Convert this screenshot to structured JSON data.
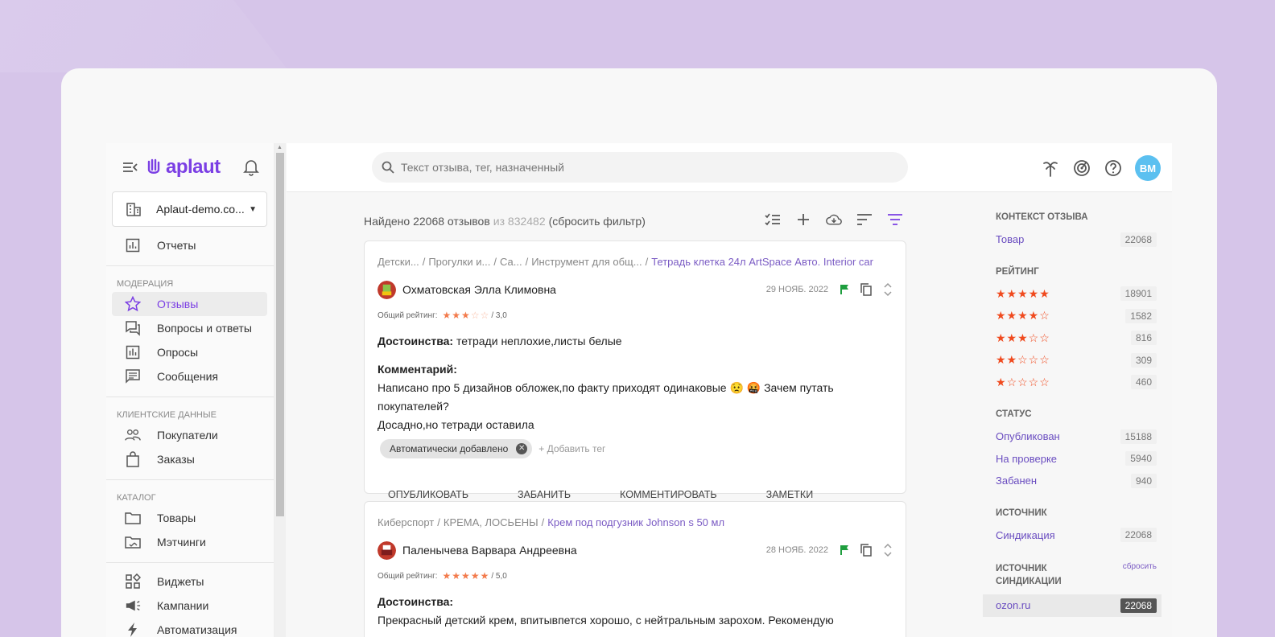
{
  "sidebar": {
    "logo_text": "aplaut",
    "company": "Aplaut-demo.co...",
    "reports": "Отчеты",
    "section_moderation": "МОДЕРАЦИЯ",
    "reviews": "Отзывы",
    "qa": "Вопросы и ответы",
    "surveys": "Опросы",
    "messages": "Сообщения",
    "section_clients": "КЛИЕНТСКИЕ ДАННЫЕ",
    "customers": "Покупатели",
    "orders": "Заказы",
    "section_catalog": "КАТАЛОГ",
    "products": "Товары",
    "matchings": "Мэтчинги",
    "widgets": "Виджеты",
    "campaigns": "Кампании",
    "automation": "Автоматизация"
  },
  "header": {
    "search_placeholder": "Текст отзыва, тег, назначенный",
    "avatar": "BM"
  },
  "summary": {
    "found": "Найдено 22068 отзывов",
    "of": "из 832482",
    "reset": "(сбросить фильтр)"
  },
  "reviews": [
    {
      "crumbs": [
        "Детски...",
        "Прогулки и...",
        "Са...",
        "Инструмент для общ..."
      ],
      "product": "Тетрадь клетка 24л ArtSpace Авто. Interior car",
      "author": "Охматовская Элла Климовна",
      "date": "29 НОЯБ. 2022",
      "rating_label": "Общий рейтинг:",
      "rating_value": "/ 3,0",
      "rating": 3,
      "pros_label": "Достоинства:",
      "pros": "тетради неплохие,листы белые",
      "comment_label": "Комментарий:",
      "comment_1": "Написано про 5 дизайнов обложек,по факту приходят одинаковые 😟 🤬 Зачем путать покупателей?",
      "comment_2": "Досадно,но тетради оставила",
      "tag": "Автоматически добавлено",
      "add_tag": "+ Добавить тег",
      "actions": [
        "ОПУБЛИКОВАТЬ",
        "ЗАБАНИТЬ",
        "КОММЕНТИРОВАТЬ",
        "ЗАМЕТКИ"
      ]
    },
    {
      "crumbs": [
        "Киберспорт",
        "КРЕМА, ЛОСЬЕНЫ"
      ],
      "product": "Крем под подгузник Johnson s 50 мл",
      "author": "Паленычева Варвара Андреевна",
      "date": "28 НОЯБ. 2022",
      "rating_label": "Общий рейтинг:",
      "rating_value": "/ 5,0",
      "rating": 5,
      "pros_label": "Достоинства:",
      "pros": "Прекрасный детский крем, впитывпется хорошо, с нейтральным зарохом. Рекомендую"
    }
  ],
  "filters": {
    "context_title": "КОНТЕКСТ ОТЗЫВА",
    "context": [
      {
        "label": "Товар",
        "count": "22068"
      }
    ],
    "rating_title": "РЕЙТИНГ",
    "rating": [
      {
        "stars": 5,
        "count": "18901"
      },
      {
        "stars": 4,
        "count": "1582"
      },
      {
        "stars": 3,
        "count": "816"
      },
      {
        "stars": 2,
        "count": "309"
      },
      {
        "stars": 1,
        "count": "460"
      }
    ],
    "status_title": "СТАТУС",
    "status": [
      {
        "label": "Опубликован",
        "count": "15188"
      },
      {
        "label": "На проверке",
        "count": "5940"
      },
      {
        "label": "Забанен",
        "count": "940"
      }
    ],
    "source_title": "ИСТОЧНИК",
    "source": [
      {
        "label": "Синдикация",
        "count": "22068"
      }
    ],
    "synd_title": "ИСТОЧНИК СИНДИКАЦИИ",
    "synd_reset": "сбросить",
    "synd": [
      {
        "label": "ozon.ru",
        "count": "22068"
      }
    ]
  },
  "colors": {
    "accent": "#7b3fe4",
    "star": "#f37b4c",
    "avatar": "#5bc0f0"
  }
}
